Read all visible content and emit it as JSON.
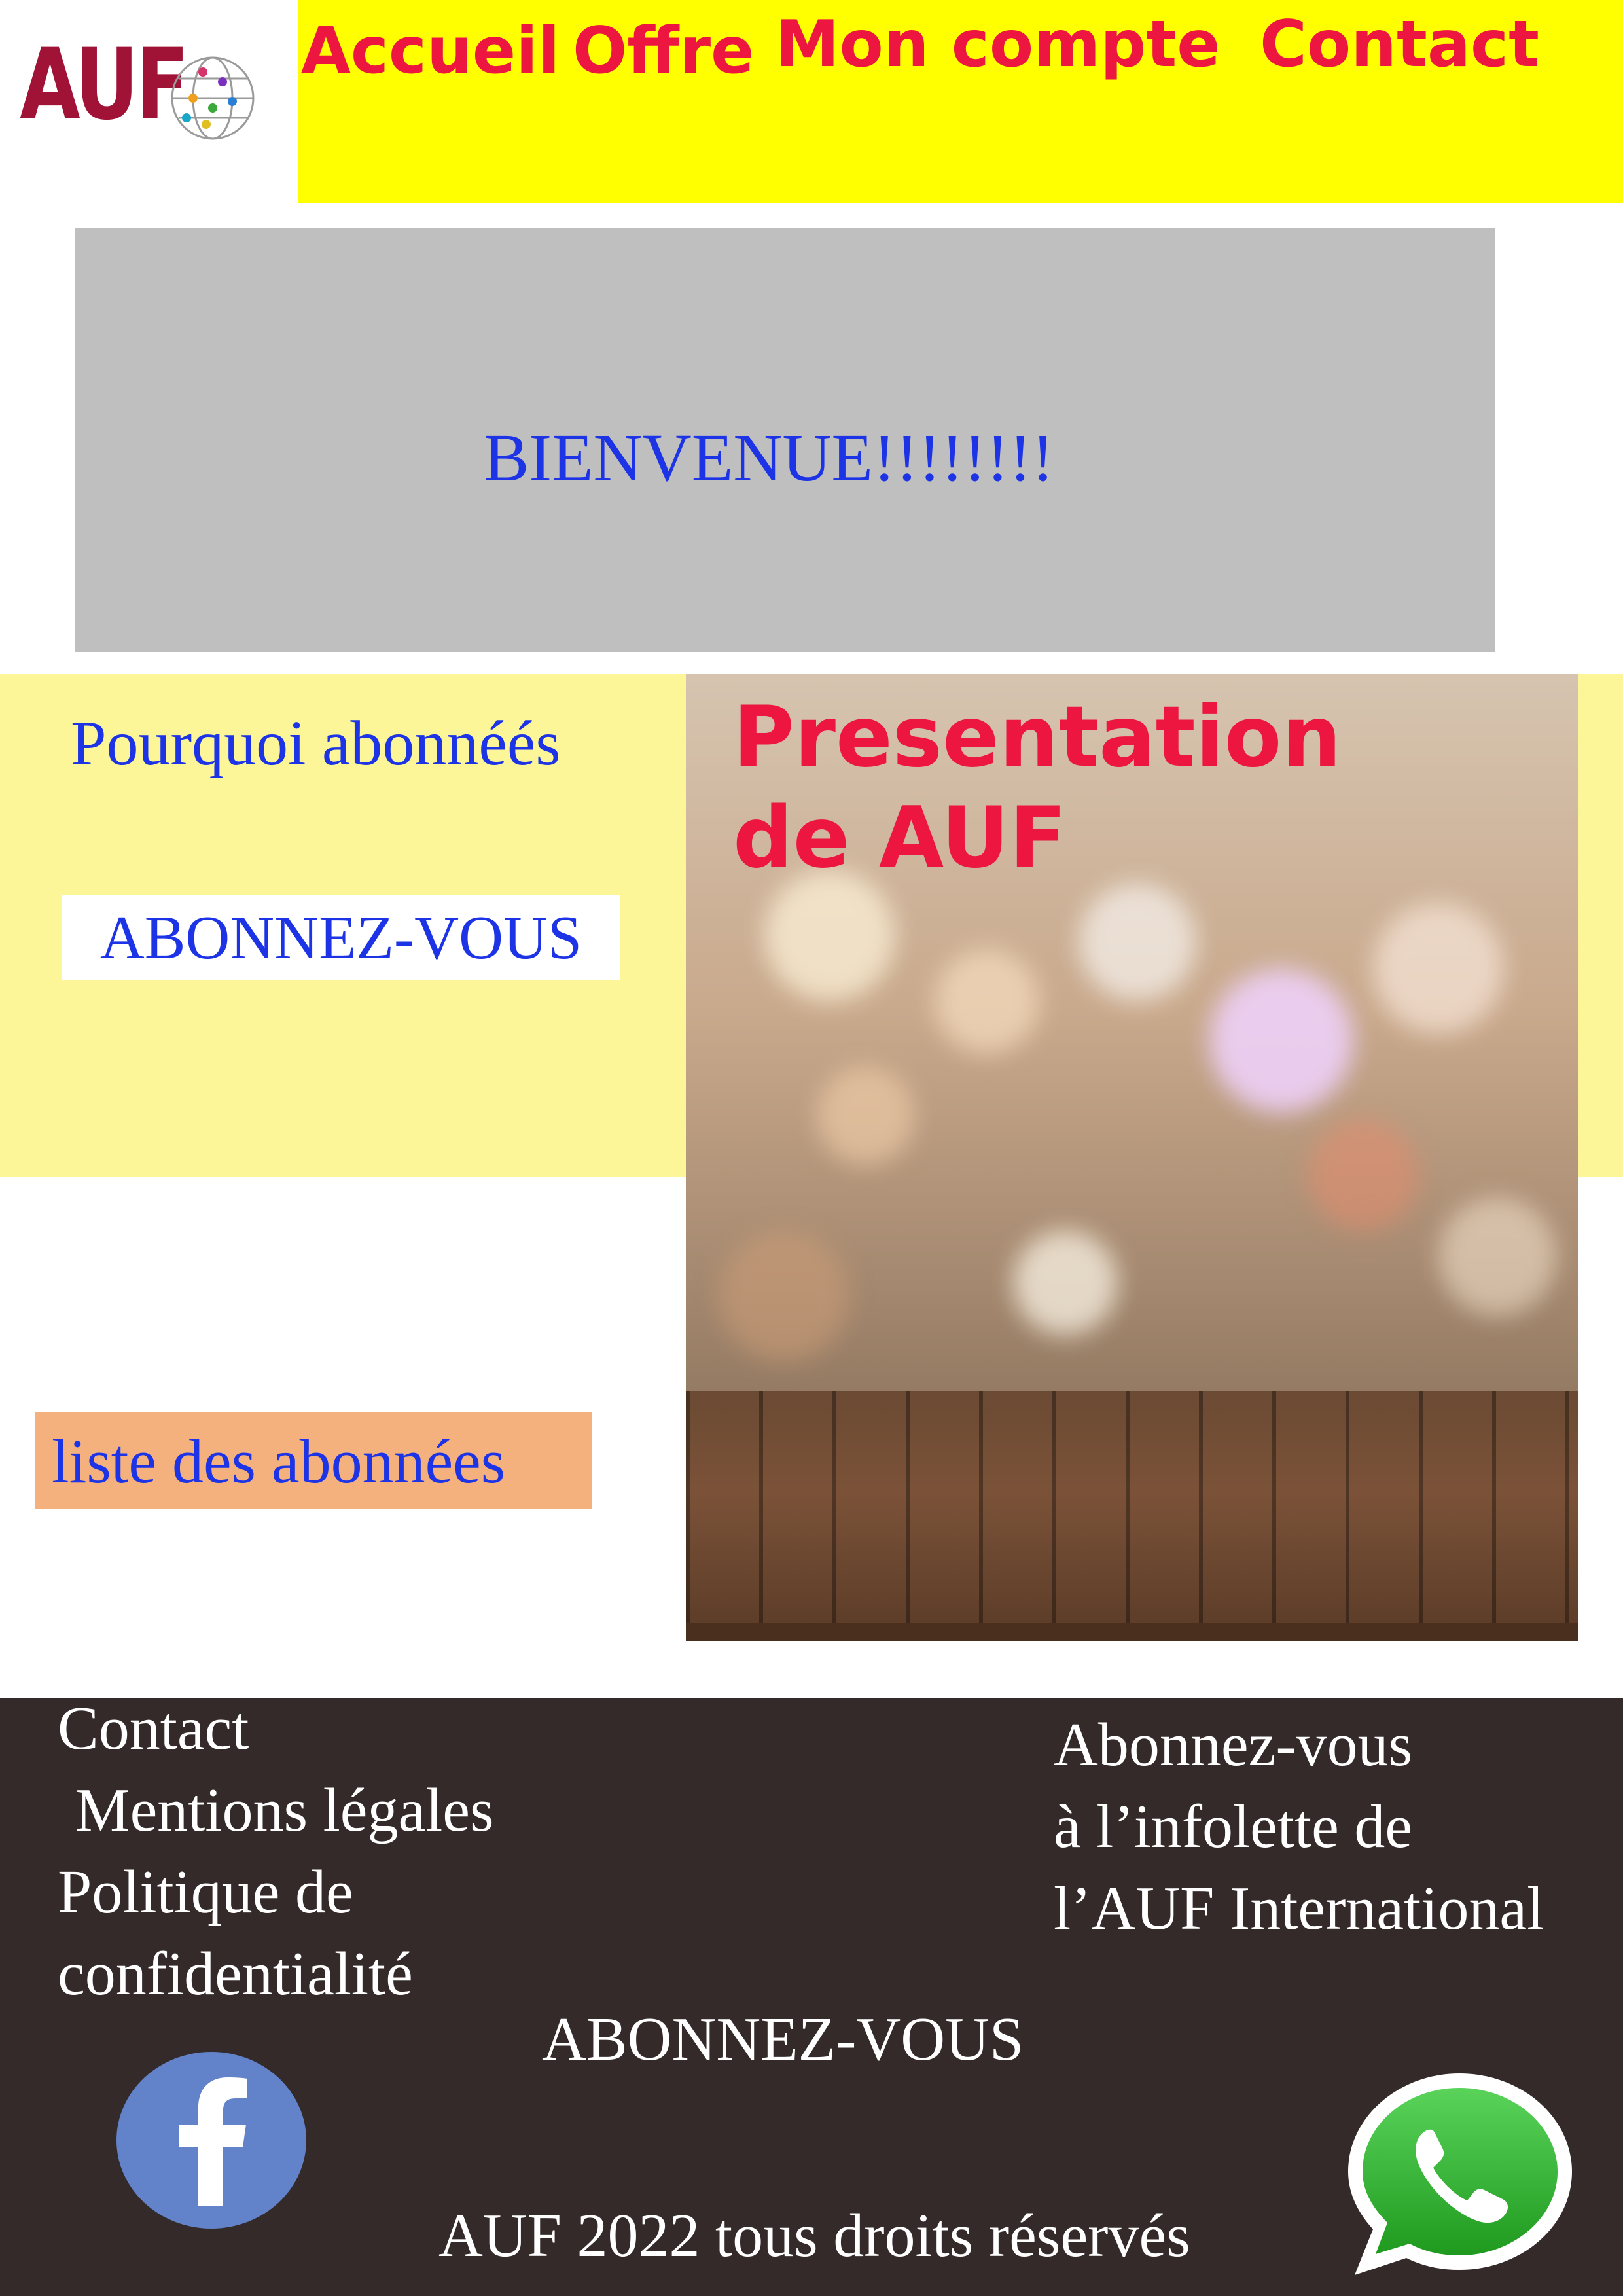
{
  "brand": {
    "logo_text": "AUF"
  },
  "nav": {
    "items": [
      {
        "label": "Accueil"
      },
      {
        "label": "Offre"
      },
      {
        "label": "Mon compte"
      },
      {
        "label": "Contact"
      }
    ]
  },
  "banner": {
    "welcome": "BIENVENUE!!!!!!!!"
  },
  "side": {
    "why_title": "Pourquoi abonnéés",
    "subscribe_label": "ABONNEZ-VOUS",
    "list_label": "liste des abonnées"
  },
  "presentation": {
    "title_line1": "Presentation",
    "title_line2": "de AUF"
  },
  "footer": {
    "links": [
      {
        "label": "Contact"
      },
      {
        "label": "Mentions légales"
      },
      {
        "label": "Politique de"
      },
      {
        "label": "confidentialité"
      }
    ],
    "newsletter_line1": "Abonnez-vous",
    "newsletter_line2": "à l’infolette de",
    "newsletter_line3": "l’AUF International",
    "subscribe_label": "ABONNEZ-VOUS",
    "copyright": "AUF 2022 tous droits réservés",
    "facebook_icon": "facebook-icon",
    "whatsapp_icon": "whatsapp-icon"
  },
  "colors": {
    "nav_bg": "#ffff00",
    "nav_text": "#ec1640",
    "link_blue": "#1c34e6",
    "banner_bg": "#bfbfbf",
    "section_yellow": "#fcf698",
    "list_btn_bg": "#f4b17e",
    "footer_bg": "#342a2a",
    "logo_red": "#a01236"
  }
}
